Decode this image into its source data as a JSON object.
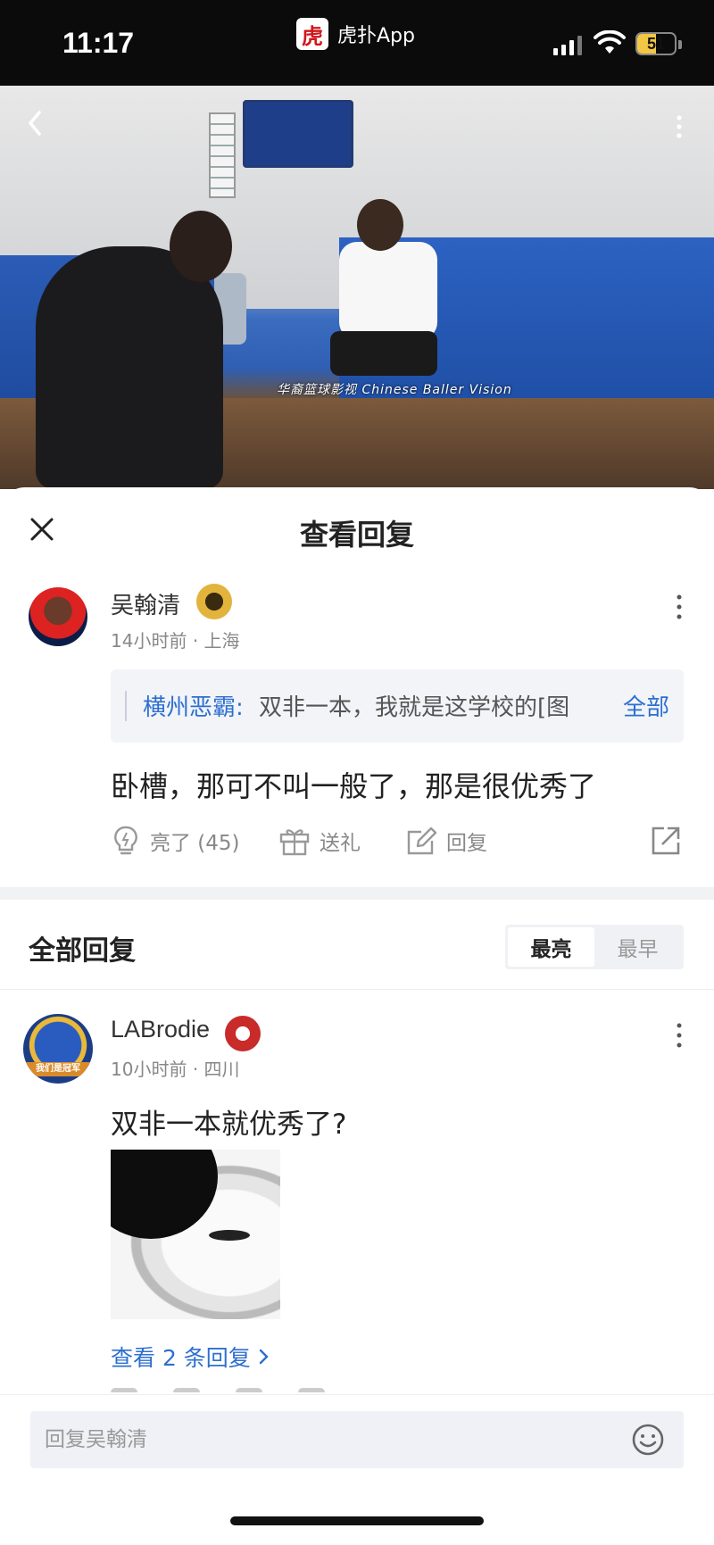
{
  "status_bar": {
    "time": "11:17",
    "app_name": "虎扑App",
    "app_logo_char": "虎",
    "battery": "51",
    "battery_level": 0.51,
    "battery_color": "#f2c744"
  },
  "video": {
    "caption": "华裔篮球影视  Chinese Baller Vision"
  },
  "sheet": {
    "title": "查看回复"
  },
  "main_comment": {
    "username": "吴翰清",
    "time": "14小时前",
    "location": "上海",
    "quote_name": "横州恶霸:",
    "quote_text": "双非一本，我就是这学校的[图",
    "quote_all": "全部",
    "text": "卧槽，那可不叫一般了，那是很优秀了",
    "actions": {
      "like": "亮了 (45)",
      "gift": "送礼",
      "reply": "回复"
    }
  },
  "replies_section": {
    "title": "全部回复",
    "sort_options": [
      "最亮",
      "最早"
    ],
    "active_sort": "最亮"
  },
  "reply": {
    "username": "LABrodie",
    "avatar_label": "我们是冠军",
    "time": "10小时前",
    "location": "四川",
    "text": "双非一本就优秀了?",
    "view_replies": "查看 2 条回复"
  },
  "input": {
    "placeholder": "回复吴翰清"
  },
  "colors": {
    "accent": "#2d6fd0",
    "status_bar_bg": "#0b0b0b",
    "logo_red": "#d0161b"
  }
}
